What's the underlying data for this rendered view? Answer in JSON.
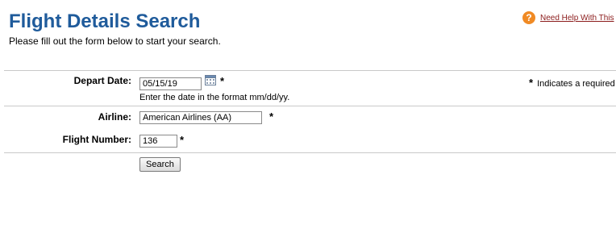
{
  "page": {
    "title": "Flight Details Search",
    "subtitle": "Please fill out the form below to start your search.",
    "help_link": "Need Help With This",
    "help_icon": "question-circle-icon",
    "required_star": "*",
    "required_note": "Indicates a required"
  },
  "form": {
    "depart_date": {
      "label": "Depart Date:",
      "value": "05/15/19",
      "hint": "Enter the date in the format mm/dd/yy.",
      "icon": "calendar-icon"
    },
    "airline": {
      "label": "Airline:",
      "value": "American Airlines (AA)"
    },
    "flight_number": {
      "label": "Flight Number:",
      "value": "136"
    },
    "search_button": "Search"
  },
  "colors": {
    "title": "#1f5b9b",
    "help_icon": "#f08a24",
    "help_link": "#8b1b1b",
    "rule": "#c9c9c9"
  }
}
